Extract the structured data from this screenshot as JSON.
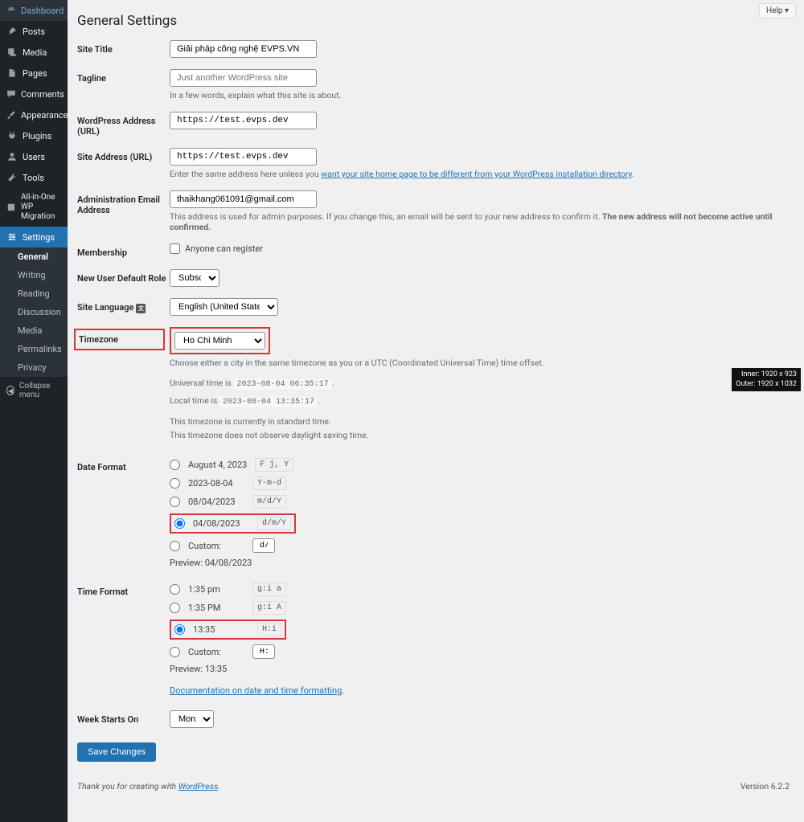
{
  "help": "Help ▾",
  "sidebar": {
    "items": [
      {
        "label": "Dashboard"
      },
      {
        "label": "Posts"
      },
      {
        "label": "Media"
      },
      {
        "label": "Pages"
      },
      {
        "label": "Comments"
      },
      {
        "label": "Appearance"
      },
      {
        "label": "Plugins"
      },
      {
        "label": "Users"
      },
      {
        "label": "Tools"
      },
      {
        "label": "All-in-One WP Migration"
      },
      {
        "label": "Settings"
      }
    ],
    "submenu": [
      {
        "label": "General"
      },
      {
        "label": "Writing"
      },
      {
        "label": "Reading"
      },
      {
        "label": "Discussion"
      },
      {
        "label": "Media"
      },
      {
        "label": "Permalinks"
      },
      {
        "label": "Privacy"
      }
    ],
    "collapse": "Collapse menu"
  },
  "page": {
    "title": "General Settings"
  },
  "form": {
    "site_title_label": "Site Title",
    "site_title_value": "Giải pháp công nghệ EVPS.VN",
    "tagline_label": "Tagline",
    "tagline_placeholder": "Just another WordPress site",
    "tagline_desc": "In a few words, explain what this site is about.",
    "wp_url_label": "WordPress Address (URL)",
    "wp_url_value": "https://test.evps.dev",
    "site_url_label": "Site Address (URL)",
    "site_url_value": "https://test.evps.dev",
    "site_url_desc_a": "Enter the same address here unless you ",
    "site_url_desc_link": "want your site home page to be different from your WordPress installation directory",
    "admin_email_label": "Administration Email Address",
    "admin_email_value": "thaikhang061091@gmail.com",
    "admin_email_desc_a": "This address is used for admin purposes. If you change this, an email will be sent to your new address to confirm it. ",
    "admin_email_desc_b": "The new address will not become active until confirmed.",
    "membership_label": "Membership",
    "membership_checkbox": "Anyone can register",
    "default_role_label": "New User Default Role",
    "default_role_value": "Subscriber",
    "site_lang_label": "Site Language",
    "site_lang_value": "English (United States)",
    "timezone_label": "Timezone",
    "timezone_value": "Ho Chi Minh",
    "timezone_desc": "Choose either a city in the same timezone as you or a UTC (Coordinated Universal Time) time offset.",
    "universal_time": "Universal time is ",
    "universal_time_val": "2023-08-04 06:35:17",
    "local_time": "Local time is ",
    "local_time_val": "2023-08-04 13:35:17",
    "tz_std": "This timezone is currently in standard time.",
    "tz_dst": "This timezone does not observe daylight saving time.",
    "date_format_label": "Date Format",
    "date_formats": [
      {
        "display": "August 4, 2023",
        "code": "F j, Y"
      },
      {
        "display": "2023-08-04",
        "code": "Y-m-d"
      },
      {
        "display": "08/04/2023",
        "code": "m/d/Y"
      },
      {
        "display": "04/08/2023",
        "code": "d/m/Y"
      }
    ],
    "custom_label": "Custom:",
    "date_custom_value": "d/m/Y",
    "date_preview_label": "Preview: ",
    "date_preview_value": "04/08/2023",
    "time_format_label": "Time Format",
    "time_formats": [
      {
        "display": "1:35 pm",
        "code": "g:i a"
      },
      {
        "display": "1:35 PM",
        "code": "g:i A"
      },
      {
        "display": "13:35",
        "code": "H:i"
      }
    ],
    "time_custom_value": "H:i",
    "time_preview_label": "Preview: ",
    "time_preview_value": "13:35",
    "doc_link": "Documentation on date and time formatting",
    "week_start_label": "Week Starts On",
    "week_start_value": "Monday",
    "save_button": "Save Changes"
  },
  "footer": {
    "thanks": "Thank you for creating with ",
    "wp": "WordPress",
    "version": "Version 6.2.2"
  },
  "viewport": {
    "inner": "Inner: 1920 x 923",
    "outer": "Outer: 1920 x 1032"
  }
}
